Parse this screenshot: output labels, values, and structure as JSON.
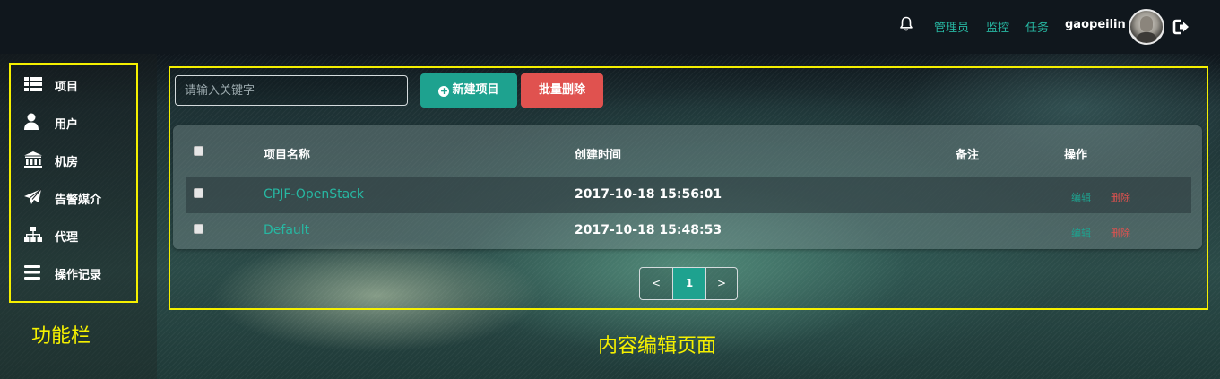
{
  "header": {
    "nav": [
      {
        "label": "管理员"
      },
      {
        "label": "监控"
      },
      {
        "label": "任务"
      }
    ],
    "username": "gaopeilin",
    "icons": {
      "notification": "bell-icon",
      "logout": "logout-icon"
    }
  },
  "sidebar": {
    "items": [
      {
        "label": "项目",
        "icon": "list-icon"
      },
      {
        "label": "用户",
        "icon": "user-icon"
      },
      {
        "label": "机房",
        "icon": "bank-icon"
      },
      {
        "label": "告警媒介",
        "icon": "paper-plane-icon"
      },
      {
        "label": "代理",
        "icon": "sitemap-icon"
      },
      {
        "label": "操作记录",
        "icon": "bars-icon"
      }
    ]
  },
  "annotations": {
    "sidebar_caption": "功能栏",
    "content_caption": "内容编辑页面"
  },
  "toolbar": {
    "search_placeholder": "请输入关键字",
    "new_label": "新建项目",
    "batch_delete_label": "批量删除"
  },
  "table": {
    "columns": [
      "项目名称",
      "创建时间",
      "备注",
      "操作"
    ],
    "rows": [
      {
        "name": "CPJF-OpenStack",
        "created": "2017-10-18 15:56:01",
        "note": "",
        "edit": "编辑",
        "delete": "删除"
      },
      {
        "name": "Default",
        "created": "2017-10-18 15:48:53",
        "note": "",
        "edit": "编辑",
        "delete": "删除"
      }
    ]
  },
  "pagination": {
    "prev": "<",
    "current": "1",
    "next": ">"
  },
  "colors": {
    "accent": "#1ea28f",
    "danger": "#e0524f",
    "link": "#27b7a2",
    "highlight_box": "#f5f000"
  }
}
